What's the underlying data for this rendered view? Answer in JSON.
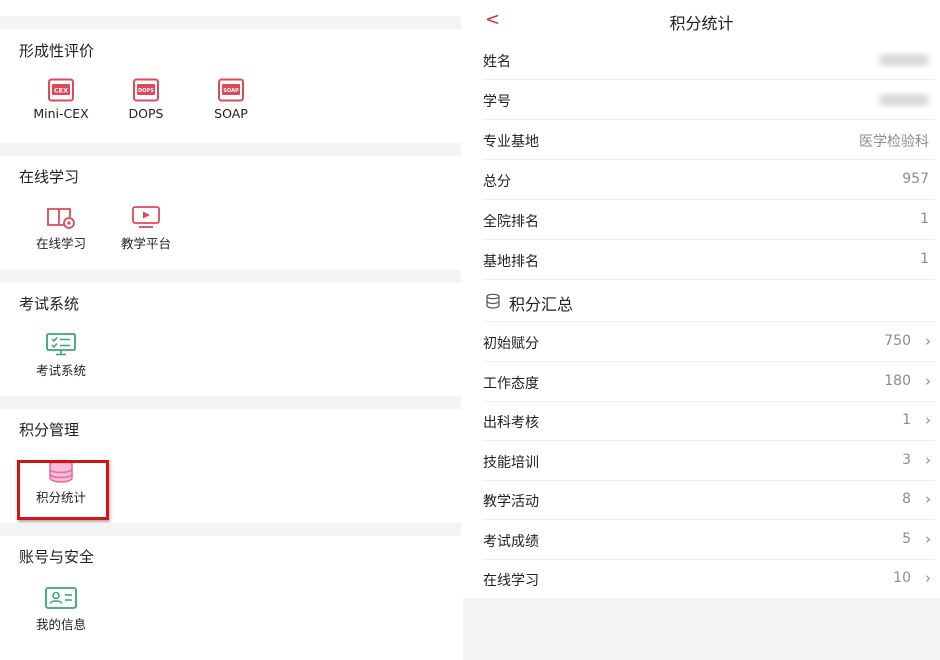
{
  "sections": {
    "formative": {
      "title": "形成性评价",
      "items": [
        {
          "label": "Mini-CEX",
          "icon": "cex-icon",
          "badge": "CEX"
        },
        {
          "label": "DOPS",
          "icon": "dops-icon",
          "badge": "DOPS"
        },
        {
          "label": "SOAP",
          "icon": "soap-icon",
          "badge": "SOAP"
        }
      ]
    },
    "online": {
      "title": "在线学习",
      "items": [
        {
          "label": "在线学习",
          "icon": "book-icon"
        },
        {
          "label": "教学平台",
          "icon": "video-icon"
        }
      ]
    },
    "exam": {
      "title": "考试系统",
      "items": [
        {
          "label": "考试系统",
          "icon": "exam-screen-icon"
        }
      ]
    },
    "points": {
      "title": "积分管理",
      "items": [
        {
          "label": "积分统计",
          "icon": "database-icon"
        }
      ]
    },
    "account": {
      "title": "账号与安全",
      "items": [
        {
          "label": "我的信息",
          "icon": "id-card-icon"
        }
      ]
    }
  },
  "detail": {
    "back": "<",
    "title": "积分统计",
    "info": [
      {
        "key": "姓名",
        "value": ""
      },
      {
        "key": "学号",
        "value": ""
      },
      {
        "key": "专业基地",
        "value": "医学检验科"
      },
      {
        "key": "总分",
        "value": "957"
      },
      {
        "key": "全院排名",
        "value": "1"
      },
      {
        "key": "基地排名",
        "value": "1"
      }
    ],
    "summary_title": "积分汇总",
    "summary": [
      {
        "key": "初始赋分",
        "value": "750"
      },
      {
        "key": "工作态度",
        "value": "180"
      },
      {
        "key": "出科考核",
        "value": "1"
      },
      {
        "key": "技能培训",
        "value": "3"
      },
      {
        "key": "教学活动",
        "value": "8"
      },
      {
        "key": "考试成绩",
        "value": "5"
      },
      {
        "key": "在线学习",
        "value": "10"
      }
    ],
    "chevron": "›"
  },
  "colors": {
    "formative_icon": "#e0485a",
    "online_icon": "#e0485a",
    "exam_icon": "#3aa66d",
    "points_icon": "#e96aa3",
    "account_icon": "#3aa66d",
    "highlight": "#d11414",
    "back_arrow": "#c0392b"
  }
}
